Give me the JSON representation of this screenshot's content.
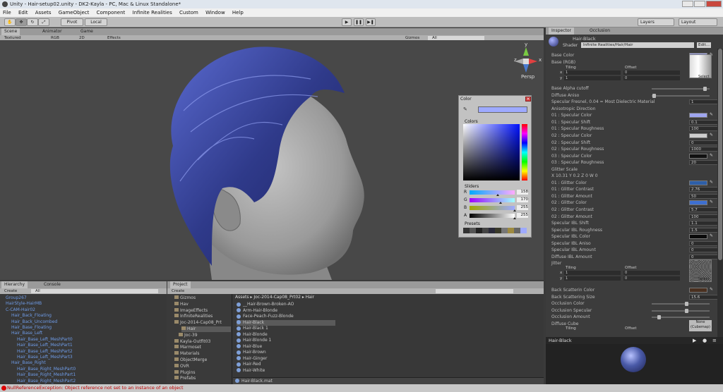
{
  "window": {
    "title": "Unity - Hair-setup02.unity - DK2-Kayla - PC, Mac & Linux Standalone*"
  },
  "menu": [
    "File",
    "Edit",
    "Assets",
    "GameObject",
    "Component",
    "Infinite Realities",
    "Custom",
    "Window",
    "Help"
  ],
  "toolbar": {
    "pivot": "Pivot",
    "local": "Local",
    "layers": "Layers",
    "layout": "Layout"
  },
  "scene": {
    "tabs": [
      "Scene",
      "Animator",
      "Game"
    ],
    "shading": "Textured",
    "render": "RGB",
    "mode2d": "2D",
    "effects": "Effects",
    "gizmos": "Gizmos",
    "all": "All",
    "persp": "Persp",
    "axes": {
      "y": "y",
      "x": "x",
      "z": "z"
    }
  },
  "color_picker": {
    "title": "Color",
    "colors_label": "Colors",
    "sliders_label": "Sliders",
    "presets_label": "Presets",
    "sliders": [
      {
        "name": "R",
        "value": "158",
        "level": 0.62
      },
      {
        "name": "G",
        "value": "170",
        "level": 0.67
      },
      {
        "name": "B",
        "value": "255",
        "level": 1
      },
      {
        "name": "A",
        "value": "255",
        "level": 1
      }
    ],
    "color": "#9eaaff"
  },
  "inspector": {
    "tabs": [
      "Inspector",
      "Occlusion"
    ],
    "material": "Hair-Black",
    "shader_label": "Shader",
    "shader": "Infinite Realities/Hair/Hair",
    "edit": "Edit...",
    "tiling": "Tiling",
    "offset": "Offset",
    "select": "Select",
    "x": "x",
    "y": "y",
    "rows": [
      {
        "label": "Base Color",
        "kind": "color",
        "color": "#a8b0ff"
      },
      {
        "label": "Base (RGB)",
        "kind": "tex"
      },
      {
        "label": "Base Alpha cutoff",
        "kind": "slider",
        "level": 0.93
      },
      {
        "label": "Diffuse Aniso",
        "kind": "slider",
        "level": 0.01
      },
      {
        "label": "Specular Fresnel, 0.04 = Most Dielectric Material",
        "kind": "value",
        "value": "1"
      },
      {
        "label": "Anisotropic Direction",
        "kind": "none"
      },
      {
        "label": "01 : Specular Color",
        "kind": "color",
        "color": "#9fa6f0"
      },
      {
        "label": "01 : Specular Shift",
        "kind": "value",
        "value": "0.1"
      },
      {
        "label": "01 : Specular Roughness",
        "kind": "value",
        "value": "100"
      },
      {
        "label": "02 : Specular Color",
        "kind": "color",
        "color": "#cfcfcf"
      },
      {
        "label": "02 : Specular Shift",
        "kind": "value",
        "value": "0"
      },
      {
        "label": "02 : Specular Roughness",
        "kind": "value",
        "value": "1000"
      },
      {
        "label": "03 : Specular Color",
        "kind": "color",
        "color": "#111111"
      },
      {
        "label": "03 : Specular Roughness",
        "kind": "value",
        "value": "20"
      },
      {
        "label": "Glitter Scale",
        "kind": "none"
      },
      {
        "label": "X 10.31     Y 0.2       Z 0        W 0",
        "kind": "none"
      },
      {
        "label": "01 : Glitter Color",
        "kind": "color",
        "color": "#2e5fa8"
      },
      {
        "label": "01 : Glitter Contrast",
        "kind": "value",
        "value": "2.76"
      },
      {
        "label": "01 : Glitter Amount",
        "kind": "value",
        "value": "50"
      },
      {
        "label": "02 : Glitter Color",
        "kind": "color",
        "color": "#3e6fd0"
      },
      {
        "label": "02 : Glitter Contrast",
        "kind": "value",
        "value": "5.7"
      },
      {
        "label": "02 : Glitter Amount",
        "kind": "value",
        "value": "100"
      },
      {
        "label": "Specular IBL Shift",
        "kind": "value",
        "value": "1.1"
      },
      {
        "label": "Specular IBL Roughness",
        "kind": "value",
        "value": "1.5"
      },
      {
        "label": "Specular IBL Color",
        "kind": "color",
        "color": "#0a0a0a"
      },
      {
        "label": "Specular IBL Aniso",
        "kind": "value",
        "value": "0"
      },
      {
        "label": "Specular IBL Amount",
        "kind": "value",
        "value": "0"
      },
      {
        "label": "Diffuse IBL Amount",
        "kind": "value",
        "value": "0"
      },
      {
        "label": "Jitter",
        "kind": "tex2"
      },
      {
        "label": "Back Scatterin Color",
        "kind": "color",
        "color": "#4a3020"
      },
      {
        "label": "Back Scattering Size",
        "kind": "value",
        "value": "15.6"
      },
      {
        "label": "Occlusion Color",
        "kind": "slider",
        "level": 0.6
      },
      {
        "label": "Occlusion Specular",
        "kind": "slider",
        "level": 0.6
      },
      {
        "label": "Occlusion Amount",
        "kind": "slider",
        "level": 0.1
      },
      {
        "label": "Diffuse Cube",
        "kind": "cube"
      }
    ],
    "tiling_rows": {
      "x1": "1",
      "x2": "0",
      "y1": "1",
      "y2": "0"
    },
    "cube_none": "None",
    "cube_sub": "(Cubemap)",
    "preview_title": "Hair-Black"
  },
  "hierarchy": {
    "tabs": [
      "Hierarchy",
      "Console"
    ],
    "create": "Create",
    "search": "All",
    "items": [
      {
        "t": "Group267",
        "i": 0
      },
      {
        "t": "HairStyle-HairMB",
        "i": 0
      },
      {
        "t": "C-CAM-Hair02",
        "i": 0
      },
      {
        "t": "Hair_Back_Floating",
        "i": 1
      },
      {
        "t": "Hair_Back_Uncombed",
        "i": 1
      },
      {
        "t": "Hair_Base_Floating",
        "i": 1
      },
      {
        "t": "Hair_Base_Left",
        "i": 1
      },
      {
        "t": "Hair_Base_Left_MeshPart0",
        "i": 2
      },
      {
        "t": "Hair_Base_Left_MeshPart1",
        "i": 2
      },
      {
        "t": "Hair_Base_Left_MeshPart2",
        "i": 2
      },
      {
        "t": "Hair_Base_Left_MeshPart3",
        "i": 2
      },
      {
        "t": "Hair_Base_Right",
        "i": 1
      },
      {
        "t": "Hair_Base_Right_MeshPart0",
        "i": 2
      },
      {
        "t": "Hair_Base_Right_MeshPart1",
        "i": 2
      },
      {
        "t": "Hair_Base_Right_MeshPart2",
        "i": 2
      }
    ]
  },
  "project": {
    "tab": "Project",
    "create": "Create",
    "folders": [
      "Gizmos",
      "Hav",
      "ImageEffects",
      "InfiniteRealities",
      "Joc-2014-Cap08_Prt",
      "Hair",
      "Joc-39",
      "Kayla-Outfit03",
      "Marmoset",
      "Materials",
      "ObjectMerge",
      "OVR",
      "Plugins",
      "Prefabs"
    ],
    "breadcrumb": "Assets ▸ Joc-2014-Cap08_Prt02 ▸ Hair",
    "files": [
      "__Hair-Brown-Broken-AO",
      "Arm-Hair-Blonde",
      "Face-Peach-Fuzz-Blonde",
      "Hair-Black",
      "Hair-Black 1",
      "Hair-Blonde",
      "Hair-Blonde 1",
      "Hair-Blue",
      "Hair-Brown",
      "Hair-Ginger",
      "Hair-Red",
      "Hair-White"
    ],
    "selected": "Hair-Black.mat"
  },
  "status": "NullReferenceException: Object reference not set to an instance of an object"
}
